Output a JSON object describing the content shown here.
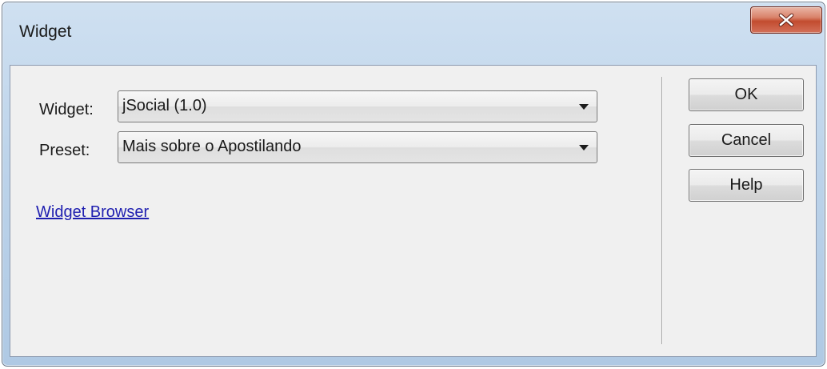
{
  "window": {
    "title": "Widget"
  },
  "form": {
    "widget_label": "Widget:",
    "widget_value": "jSocial (1.0)",
    "preset_label": "Preset:",
    "preset_value": "Mais sobre o Apostilando",
    "browser_link": "Widget Browser"
  },
  "buttons": {
    "ok": "OK",
    "cancel": "Cancel",
    "help": "Help"
  },
  "icons": {
    "close": "close-icon",
    "dropdown": "chevron-down-icon"
  },
  "colors": {
    "close_button": "#c24c2f",
    "link": "#1f1fb0",
    "client_background": "#f0f0f0"
  }
}
